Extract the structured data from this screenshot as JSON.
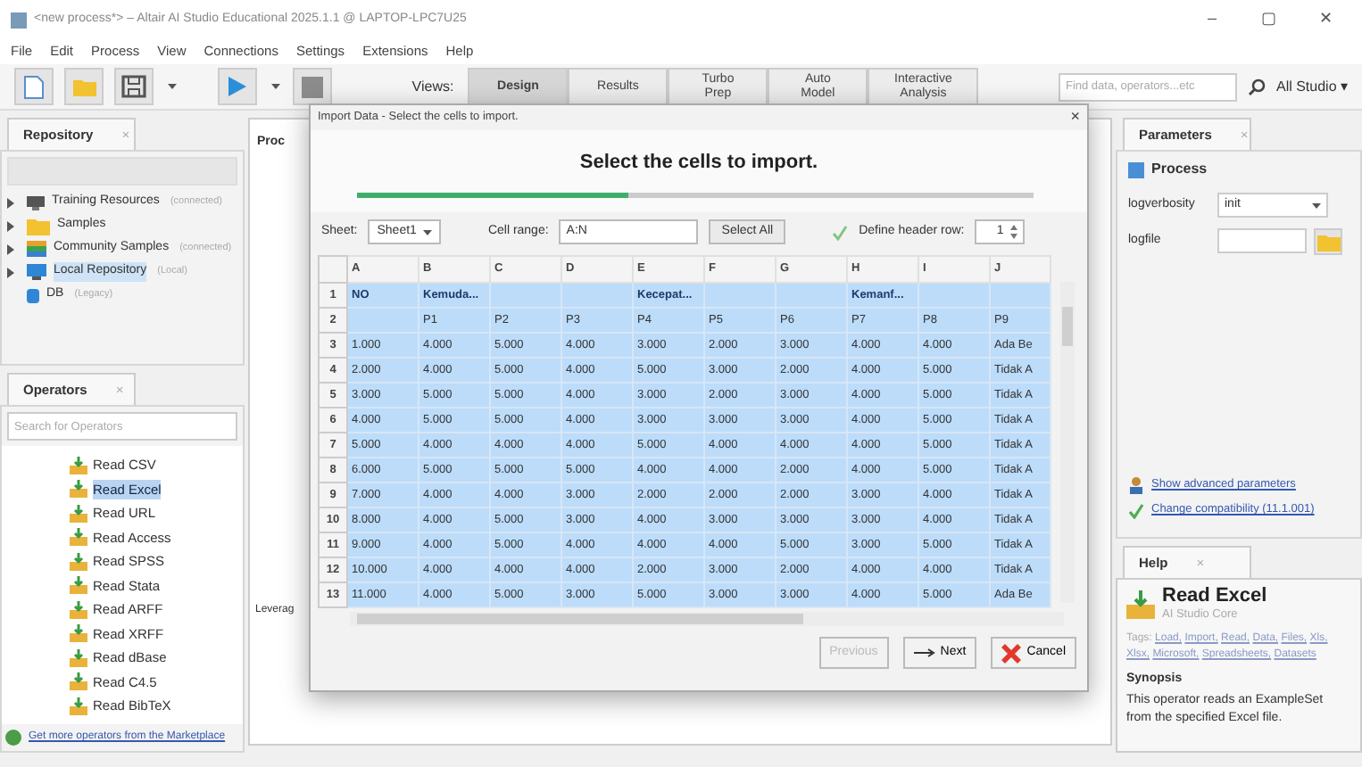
{
  "window": {
    "title": "<new process*> – Altair AI Studio Educational 2025.1.1 @ LAPTOP-LPC7U25",
    "controls": [
      "–",
      "▢",
      "✕"
    ]
  },
  "menu": [
    "File",
    "Edit",
    "Process",
    "View",
    "Connections",
    "Settings",
    "Extensions",
    "Help"
  ],
  "toolbar": {
    "views_label": "Views:",
    "views": [
      {
        "label": "Design",
        "selected": true
      },
      {
        "label": "Results",
        "selected": false
      },
      {
        "label": "Turbo Prep",
        "selected": false
      },
      {
        "label": "Auto Model",
        "selected": false
      },
      {
        "label": "Interactive Analysis",
        "selected": false
      }
    ],
    "search": {
      "placeholder": "Find data, operators...etc"
    },
    "scope": "All Studio ▾"
  },
  "repository": {
    "tab": "Repository",
    "close": "×",
    "items": [
      {
        "label": "Training Resources",
        "note": "(connected)",
        "kind": "training",
        "expandable": true,
        "selected": false
      },
      {
        "label": "Samples",
        "kind": "folder",
        "expandable": true,
        "selected": false
      },
      {
        "label": "Community Samples",
        "note": "(connected)",
        "kind": "community",
        "expandable": true,
        "selected": false
      },
      {
        "label": "Local Repository",
        "note": "(Local)",
        "kind": "local",
        "expandable": true,
        "selected": true
      },
      {
        "label": "DB",
        "note": "(Legacy)",
        "kind": "db",
        "expandable": false,
        "selected": false
      }
    ]
  },
  "operators": {
    "tab": "Operators",
    "close": "×",
    "search": {
      "placeholder": "Search for Operators"
    },
    "items": [
      {
        "label": "Read CSV",
        "selected": false
      },
      {
        "label": "Read Excel",
        "selected": true
      },
      {
        "label": "Read URL",
        "selected": false
      },
      {
        "label": "Read Access",
        "selected": false
      },
      {
        "label": "Read SPSS",
        "selected": false
      },
      {
        "label": "Read Stata",
        "selected": false
      },
      {
        "label": "Read ARFF",
        "selected": false
      },
      {
        "label": "Read XRFF",
        "selected": false
      },
      {
        "label": "Read dBase",
        "selected": false
      },
      {
        "label": "Read C4.5",
        "selected": false
      },
      {
        "label": "Read BibTeX",
        "selected": false
      }
    ],
    "marketplace": "Get more operators from the Marketplace"
  },
  "process": {
    "title": "Proc",
    "footer": "Leverag"
  },
  "dialog": {
    "title": "Import Data - Select the cells to import.",
    "close": "×",
    "heading": "Select the cells to import.",
    "progress": {
      "level": 0.4
    },
    "sheet_label": "Sheet:",
    "sheet": "Sheet1",
    "range_label": "Cell range:",
    "range": "A:N",
    "select_all": "Select All",
    "header_row": {
      "label": "Define header row:",
      "checked": true,
      "value": "1"
    },
    "table": {
      "columns": [
        "A",
        "B",
        "C",
        "D",
        "E",
        "F",
        "G",
        "H",
        "I",
        "J"
      ],
      "rows": [
        {
          "number": "1",
          "selected": true,
          "header": true,
          "cells": [
            "NO",
            "Kemuda...",
            "",
            "",
            "Kecepat...",
            "",
            "",
            "Kemanf...",
            "",
            ""
          ]
        },
        {
          "number": "2",
          "selected": true,
          "header": false,
          "cells": [
            "",
            "P1",
            "P2",
            "P3",
            "P4",
            "P5",
            "P6",
            "P7",
            "P8",
            "P9"
          ]
        },
        {
          "number": "3",
          "selected": true,
          "header": false,
          "cells": [
            "1.000",
            "4.000",
            "5.000",
            "4.000",
            "3.000",
            "2.000",
            "3.000",
            "4.000",
            "4.000",
            "Ada Be"
          ]
        },
        {
          "number": "4",
          "selected": true,
          "header": false,
          "cells": [
            "2.000",
            "4.000",
            "5.000",
            "4.000",
            "5.000",
            "3.000",
            "2.000",
            "4.000",
            "5.000",
            "Tidak A"
          ]
        },
        {
          "number": "5",
          "selected": true,
          "header": false,
          "cells": [
            "3.000",
            "5.000",
            "5.000",
            "4.000",
            "3.000",
            "2.000",
            "3.000",
            "4.000",
            "5.000",
            "Tidak A"
          ]
        },
        {
          "number": "6",
          "selected": true,
          "header": false,
          "cells": [
            "4.000",
            "5.000",
            "5.000",
            "4.000",
            "3.000",
            "3.000",
            "3.000",
            "4.000",
            "5.000",
            "Tidak A"
          ]
        },
        {
          "number": "7",
          "selected": true,
          "header": false,
          "cells": [
            "5.000",
            "4.000",
            "4.000",
            "4.000",
            "5.000",
            "4.000",
            "4.000",
            "4.000",
            "5.000",
            "Tidak A"
          ]
        },
        {
          "number": "8",
          "selected": true,
          "header": false,
          "cells": [
            "6.000",
            "5.000",
            "5.000",
            "5.000",
            "4.000",
            "4.000",
            "2.000",
            "4.000",
            "5.000",
            "Tidak A"
          ]
        },
        {
          "number": "9",
          "selected": true,
          "header": false,
          "cells": [
            "7.000",
            "4.000",
            "4.000",
            "3.000",
            "2.000",
            "2.000",
            "2.000",
            "3.000",
            "4.000",
            "Tidak A"
          ]
        },
        {
          "number": "10",
          "selected": true,
          "header": false,
          "cells": [
            "8.000",
            "4.000",
            "5.000",
            "3.000",
            "4.000",
            "3.000",
            "3.000",
            "3.000",
            "4.000",
            "Tidak A"
          ]
        },
        {
          "number": "11",
          "selected": true,
          "header": false,
          "cells": [
            "9.000",
            "4.000",
            "5.000",
            "4.000",
            "4.000",
            "4.000",
            "5.000",
            "3.000",
            "5.000",
            "Tidak A"
          ]
        },
        {
          "number": "12",
          "selected": true,
          "header": false,
          "cells": [
            "10.000",
            "4.000",
            "4.000",
            "4.000",
            "2.000",
            "3.000",
            "2.000",
            "4.000",
            "4.000",
            "Tidak A"
          ]
        },
        {
          "number": "13",
          "selected": true,
          "header": false,
          "cells": [
            "11.000",
            "4.000",
            "5.000",
            "3.000",
            "5.000",
            "3.000",
            "3.000",
            "4.000",
            "5.000",
            "Ada Be"
          ]
        }
      ]
    },
    "buttons": [
      {
        "label": "Previous",
        "kind": "previous",
        "disabled": true
      },
      {
        "label": "Next",
        "kind": "next",
        "disabled": false
      },
      {
        "label": "Cancel",
        "kind": "cancel",
        "disabled": false
      }
    ]
  },
  "parameters": {
    "tab": "Parameters",
    "close": "×",
    "operator": "Process",
    "fields": [
      {
        "label": "logverbosity",
        "kind": "select",
        "value": "init"
      },
      {
        "label": "logfile",
        "kind": "file"
      }
    ],
    "links": [
      {
        "label": "Show advanced parameters",
        "kind": "advanced"
      },
      {
        "label": "Change compatibility (11.1.001)",
        "kind": "compat"
      }
    ]
  },
  "help": {
    "tab": "Help",
    "close": "×",
    "title": "Read Excel",
    "subtitle": "AI Studio Core",
    "tags_label": "Tags:",
    "tags": [
      "Load,",
      "Import,",
      "Read,",
      "Data,",
      "Files,",
      "Xls,",
      "Xlsx,",
      "Microsoft,",
      "Spreadsheets,",
      "Datasets"
    ],
    "section": "Synopsis",
    "synopsis": "This operator reads an ExampleSet from the specified Excel file."
  }
}
